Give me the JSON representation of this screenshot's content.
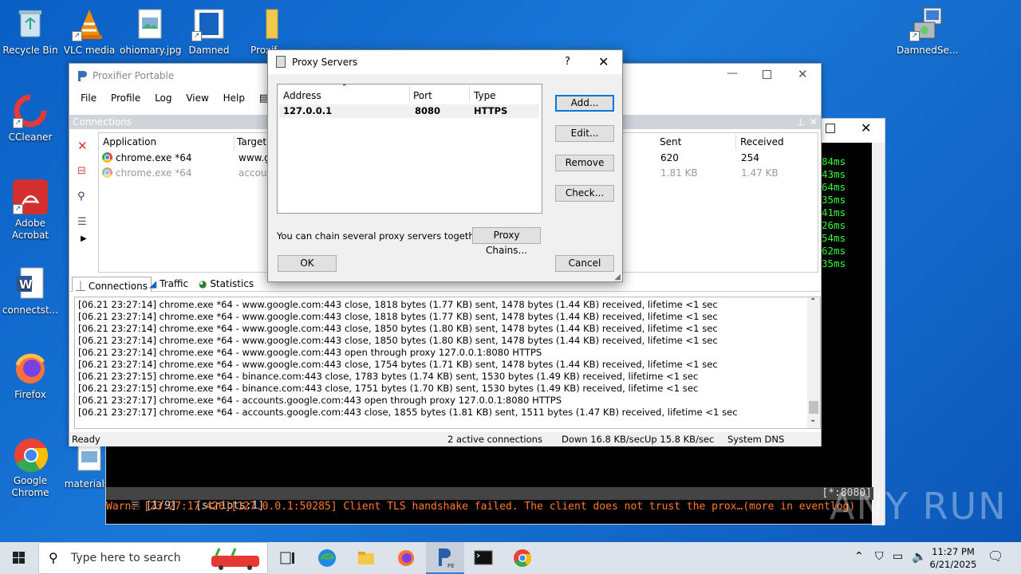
{
  "desktop": {
    "icons_left": [
      {
        "label": "Recycle Bin",
        "icon": "recycle-bin-icon"
      },
      {
        "label": "VLC media",
        "icon": "vlc-icon"
      },
      {
        "label": "ohiomary.jpg",
        "icon": "image-file-icon"
      },
      {
        "label": "Damned",
        "icon": "app-icon"
      },
      {
        "label": "Proxif...",
        "icon": "folder-icon"
      },
      {
        "label": "CCleaner",
        "icon": "ccleaner-icon"
      },
      {
        "label": "Adobe Acrobat",
        "icon": "acrobat-icon"
      },
      {
        "label": "connectst...",
        "icon": "word-icon"
      },
      {
        "label": "Firefox",
        "icon": "firefox-icon"
      },
      {
        "label": "Google Chrome",
        "icon": "chrome-icon"
      },
      {
        "label": "materialss",
        "icon": "image-file-icon"
      }
    ],
    "icon_right": {
      "label": "DamnedSe...",
      "icon": "installer-icon"
    }
  },
  "terminal": {
    "green_lines": [
      "84ms",
      "43ms",
      "64ms",
      "35ms",
      "41ms",
      "26ms",
      "54ms",
      "62ms",
      "35ms"
    ],
    "status_left": "🗏 [1/9]   [scripts:1]",
    "status_right": "[*:8080]",
    "warn": "Warn: [23:27:17.426][127.0.0.1:50285] Client TLS handshake failed. The client does not trust the prox…(more in eventlog)"
  },
  "proxifier": {
    "title": "Proxifier Portable",
    "menu": [
      "File",
      "Profile",
      "Log",
      "View",
      "Help"
    ],
    "connections_header": "Connections",
    "columns": {
      "application": "Application",
      "target": "Target",
      "sent": "Sent",
      "received": "Received"
    },
    "rows": [
      {
        "app": "chrome.exe *64",
        "target": "www.g",
        "sent": "620",
        "received": "254"
      },
      {
        "app": "chrome.exe *64",
        "target": "accoun",
        "sent": "1.81 KB",
        "received": "1.47 KB"
      }
    ],
    "tabs": [
      "Connections",
      "Traffic",
      "Statistics"
    ],
    "log": [
      "[06.21 23:27:14] chrome.exe *64 - www.google.com:443 close, 1818 bytes (1.77 KB) sent, 1478 bytes (1.44 KB) received, lifetime <1 sec",
      "[06.21 23:27:14] chrome.exe *64 - www.google.com:443 close, 1818 bytes (1.77 KB) sent, 1478 bytes (1.44 KB) received, lifetime <1 sec",
      "[06.21 23:27:14] chrome.exe *64 - www.google.com:443 close, 1850 bytes (1.80 KB) sent, 1478 bytes (1.44 KB) received, lifetime <1 sec",
      "[06.21 23:27:14] chrome.exe *64 - www.google.com:443 close, 1850 bytes (1.80 KB) sent, 1478 bytes (1.44 KB) received, lifetime <1 sec",
      "[06.21 23:27:14] chrome.exe *64 - www.google.com:443 open through proxy 127.0.0.1:8080 HTTPS",
      "[06.21 23:27:14] chrome.exe *64 - www.google.com:443 close, 1754 bytes (1.71 KB) sent, 1478 bytes (1.44 KB) received, lifetime <1 sec",
      "[06.21 23:27:15] chrome.exe *64 - binance.com:443 close, 1783 bytes (1.74 KB) sent, 1530 bytes (1.49 KB) received, lifetime <1 sec",
      "[06.21 23:27:15] chrome.exe *64 - binance.com:443 close, 1751 bytes (1.70 KB) sent, 1530 bytes (1.49 KB) received, lifetime <1 sec",
      "[06.21 23:27:17] chrome.exe *64 - accounts.google.com:443 open through proxy 127.0.0.1:8080 HTTPS",
      "[06.21 23:27:17] chrome.exe *64 - accounts.google.com:443 close, 1855 bytes (1.81 KB) sent, 1511 bytes (1.47 KB) received, lifetime <1 sec"
    ],
    "status": {
      "ready": "Ready",
      "active": "2 active connections",
      "down": "Down 16.8 KB/sec",
      "up": "Up 15.8 KB/sec",
      "dns": "System DNS"
    }
  },
  "dialog": {
    "title": "Proxy Servers",
    "help": "?",
    "columns": {
      "address": "Address",
      "port": "Port",
      "type": "Type"
    },
    "servers": [
      {
        "address": "127.0.0.1",
        "port": "8080",
        "type": "HTTPS"
      }
    ],
    "buttons": {
      "add": "Add...",
      "edit": "Edit...",
      "remove": "Remove",
      "check": "Check...",
      "chains": "Proxy Chains...",
      "ok": "OK",
      "cancel": "Cancel"
    },
    "chain_text": "You can chain several proxy servers together:"
  },
  "taskbar": {
    "search_placeholder": "Type here to search",
    "time": "11:27 PM",
    "date": "6/21/2025"
  },
  "watermark": "ANY RUN"
}
